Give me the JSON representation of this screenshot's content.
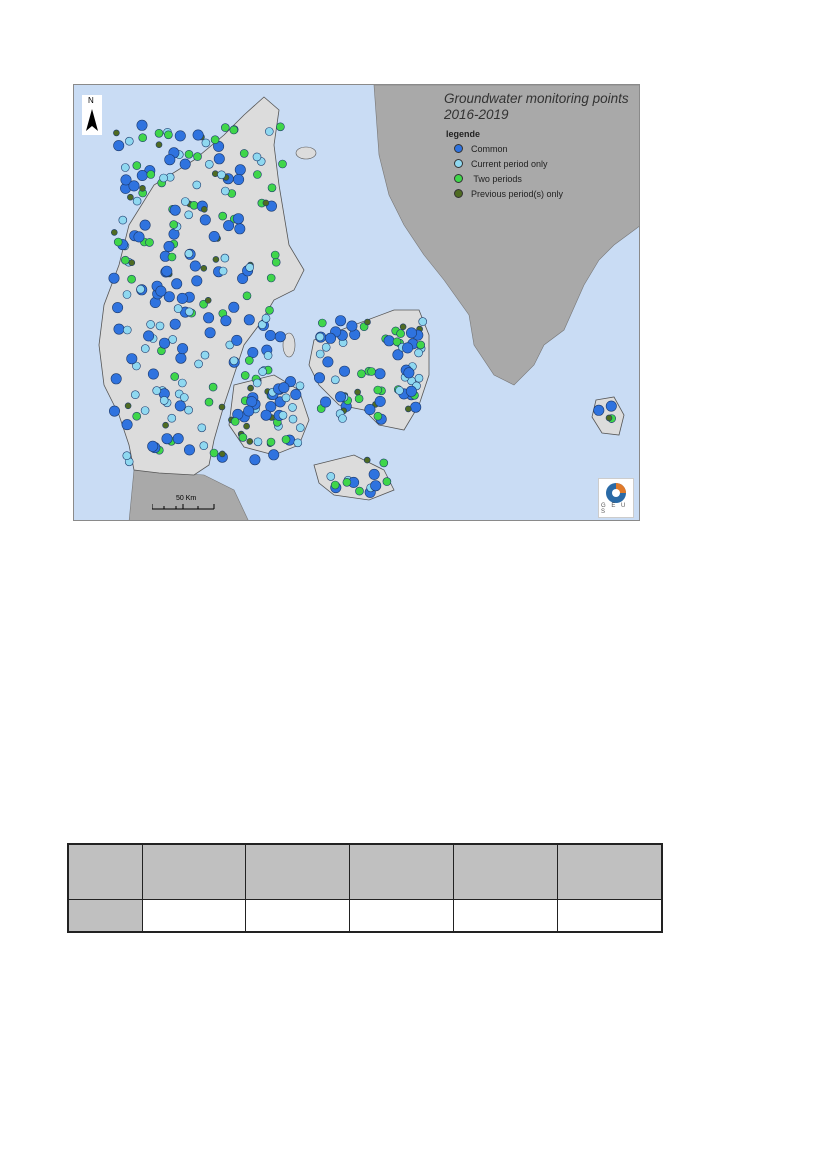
{
  "map": {
    "title_line1": "Groundwater monitoring points",
    "title_line2": "2016-2019",
    "north_label": "N",
    "scale_label": "50 Km",
    "logo_text": "G E U S",
    "legend": {
      "title": "legende",
      "items": [
        {
          "label": "Common",
          "color": "#2f73df"
        },
        {
          "label": "Current period only",
          "color": "#8fd8f0"
        },
        {
          "label": " Two periods",
          "color": "#3fd64a"
        },
        {
          "label": "Previous period(s) only",
          "color": "#4f6b22"
        }
      ]
    },
    "colors": {
      "sea": "#c9dcf4",
      "land": "#dcdcdc",
      "sweden": "#a9a9a9"
    }
  },
  "table": {
    "header": [
      "",
      "",
      "",
      "",
      "",
      ""
    ],
    "rows": [
      [
        "",
        "",
        "",
        "",
        "",
        ""
      ]
    ]
  }
}
